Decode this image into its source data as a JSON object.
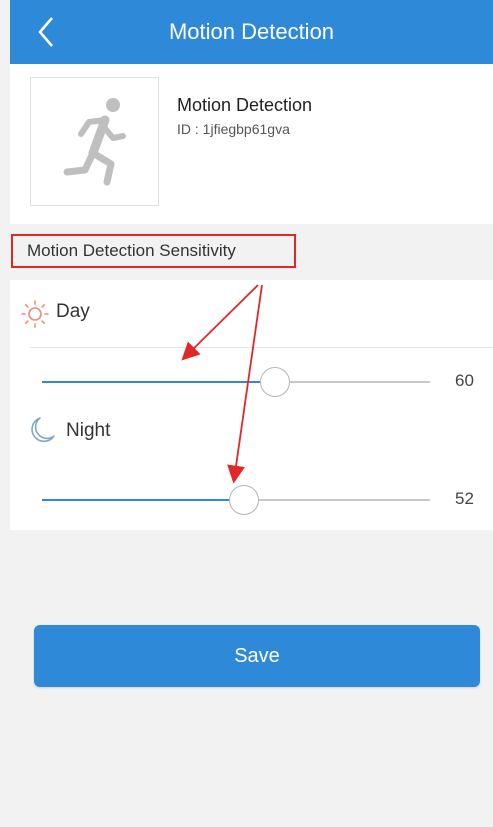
{
  "header": {
    "title": "Motion Detection",
    "back_icon": "chevron-left-icon"
  },
  "device": {
    "name": "Motion Detection",
    "id": "ID : 1jfiegbp61gva",
    "icon": "running-person-icon"
  },
  "sensitivity": {
    "section_label": "Motion Detection Sensitivity",
    "day": {
      "label": "Day",
      "icon": "sun-icon",
      "value": "60",
      "level": 0.6
    },
    "night": {
      "label": "Night",
      "icon": "moon-icon",
      "value": "52",
      "level": 0.52
    }
  },
  "actions": {
    "save_label": "Save"
  },
  "colors": {
    "accent": "#2e8ad8",
    "highlight_border": "#e02828",
    "sun": "#f08a7a",
    "moon": "#7fa9c9"
  }
}
